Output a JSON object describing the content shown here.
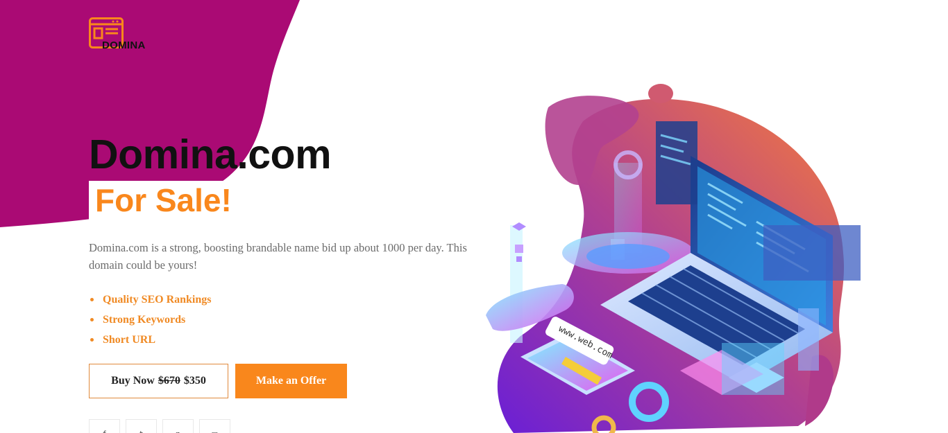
{
  "brand": {
    "name": "DOMINA",
    "logo_color": "#f9871c"
  },
  "colors": {
    "accent": "#f9871c",
    "blob": "#aa0a74",
    "heading": "#111111",
    "body_text": "#6b6b6b"
  },
  "hero": {
    "title": "Domina.com",
    "subtitle": "For Sale!",
    "description": "Domina.com is a strong, boosting brandable name bid up about 1000 per day. This domain could be yours!"
  },
  "features": [
    "Quality SEO Rankings",
    "Strong Keywords",
    "Short URL"
  ],
  "actions": {
    "buy_label": "Buy Now",
    "old_price": "$670",
    "new_price": "$350",
    "offer_label": "Make an Offer"
  },
  "social": [
    {
      "icon": "facebook-icon",
      "glyph": "f"
    },
    {
      "icon": "twitter-icon",
      "glyph": "t"
    },
    {
      "icon": "pinterest-icon",
      "glyph": "p"
    },
    {
      "icon": "instagram-icon",
      "glyph": "◻"
    }
  ],
  "illustration": {
    "url_tag": "www.web.com"
  }
}
